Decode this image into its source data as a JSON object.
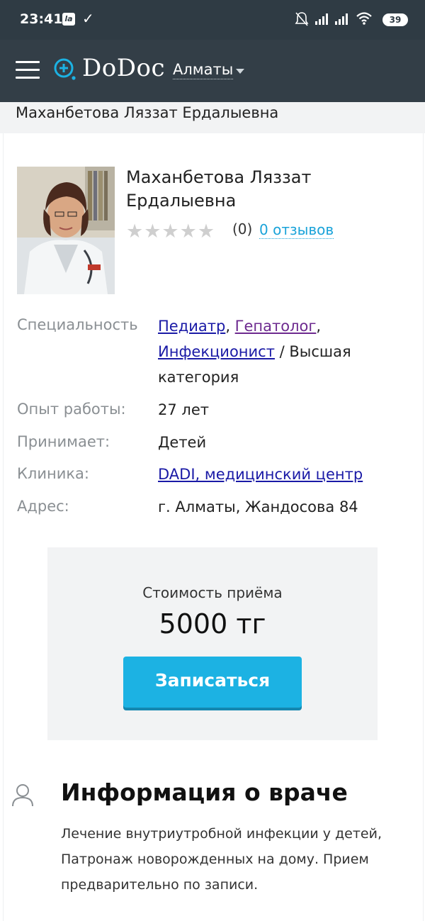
{
  "status_bar": {
    "time": "23:41",
    "battery": "39",
    "app_icon_label": "la"
  },
  "header": {
    "logo": "DoDoc",
    "city": "Алматы"
  },
  "breadcrumb": "Маханбетова Ляззат Ердалыевна",
  "doctor": {
    "name": "Маханбетова Ляззат Ердалыевна",
    "stars": "★★★★★",
    "rating_count": "(0)",
    "reviews_link": "0 отзывов"
  },
  "info": {
    "specialty_label": "Специальность",
    "specialties": [
      "Педиатр",
      "Гепатолог",
      "Инфекционист"
    ],
    "specialty_sep1": ", ",
    "specialty_sep2": ",",
    "category": " / Высшая категория",
    "experience_label": "Опыт работы:",
    "experience_value": "27 лет",
    "accepts_label": "Принимает:",
    "accepts_value": "Детей",
    "clinic_label": "Клиника:",
    "clinic_value": "DADI, медицинский центр",
    "address_label": "Адрес:",
    "address_value": "г. Алматы, Жандосова 84"
  },
  "price": {
    "label": "Стоимость приёма",
    "value": "5000 тг",
    "button": "Записаться"
  },
  "about": {
    "title": "Информация о враче",
    "text": "Лечение внутриутробной инфекции у детей, Патронаж новорожденных на дому. Прием предварительно по записи."
  },
  "colors": {
    "header_bg": "#333e47",
    "accent": "#1cb2e3",
    "link": "#1a1aa6"
  },
  "icons": [
    "hamburger-icon",
    "logo-icon",
    "user-icon",
    "wifi-icon",
    "signal-icon",
    "bell-off-icon"
  ]
}
